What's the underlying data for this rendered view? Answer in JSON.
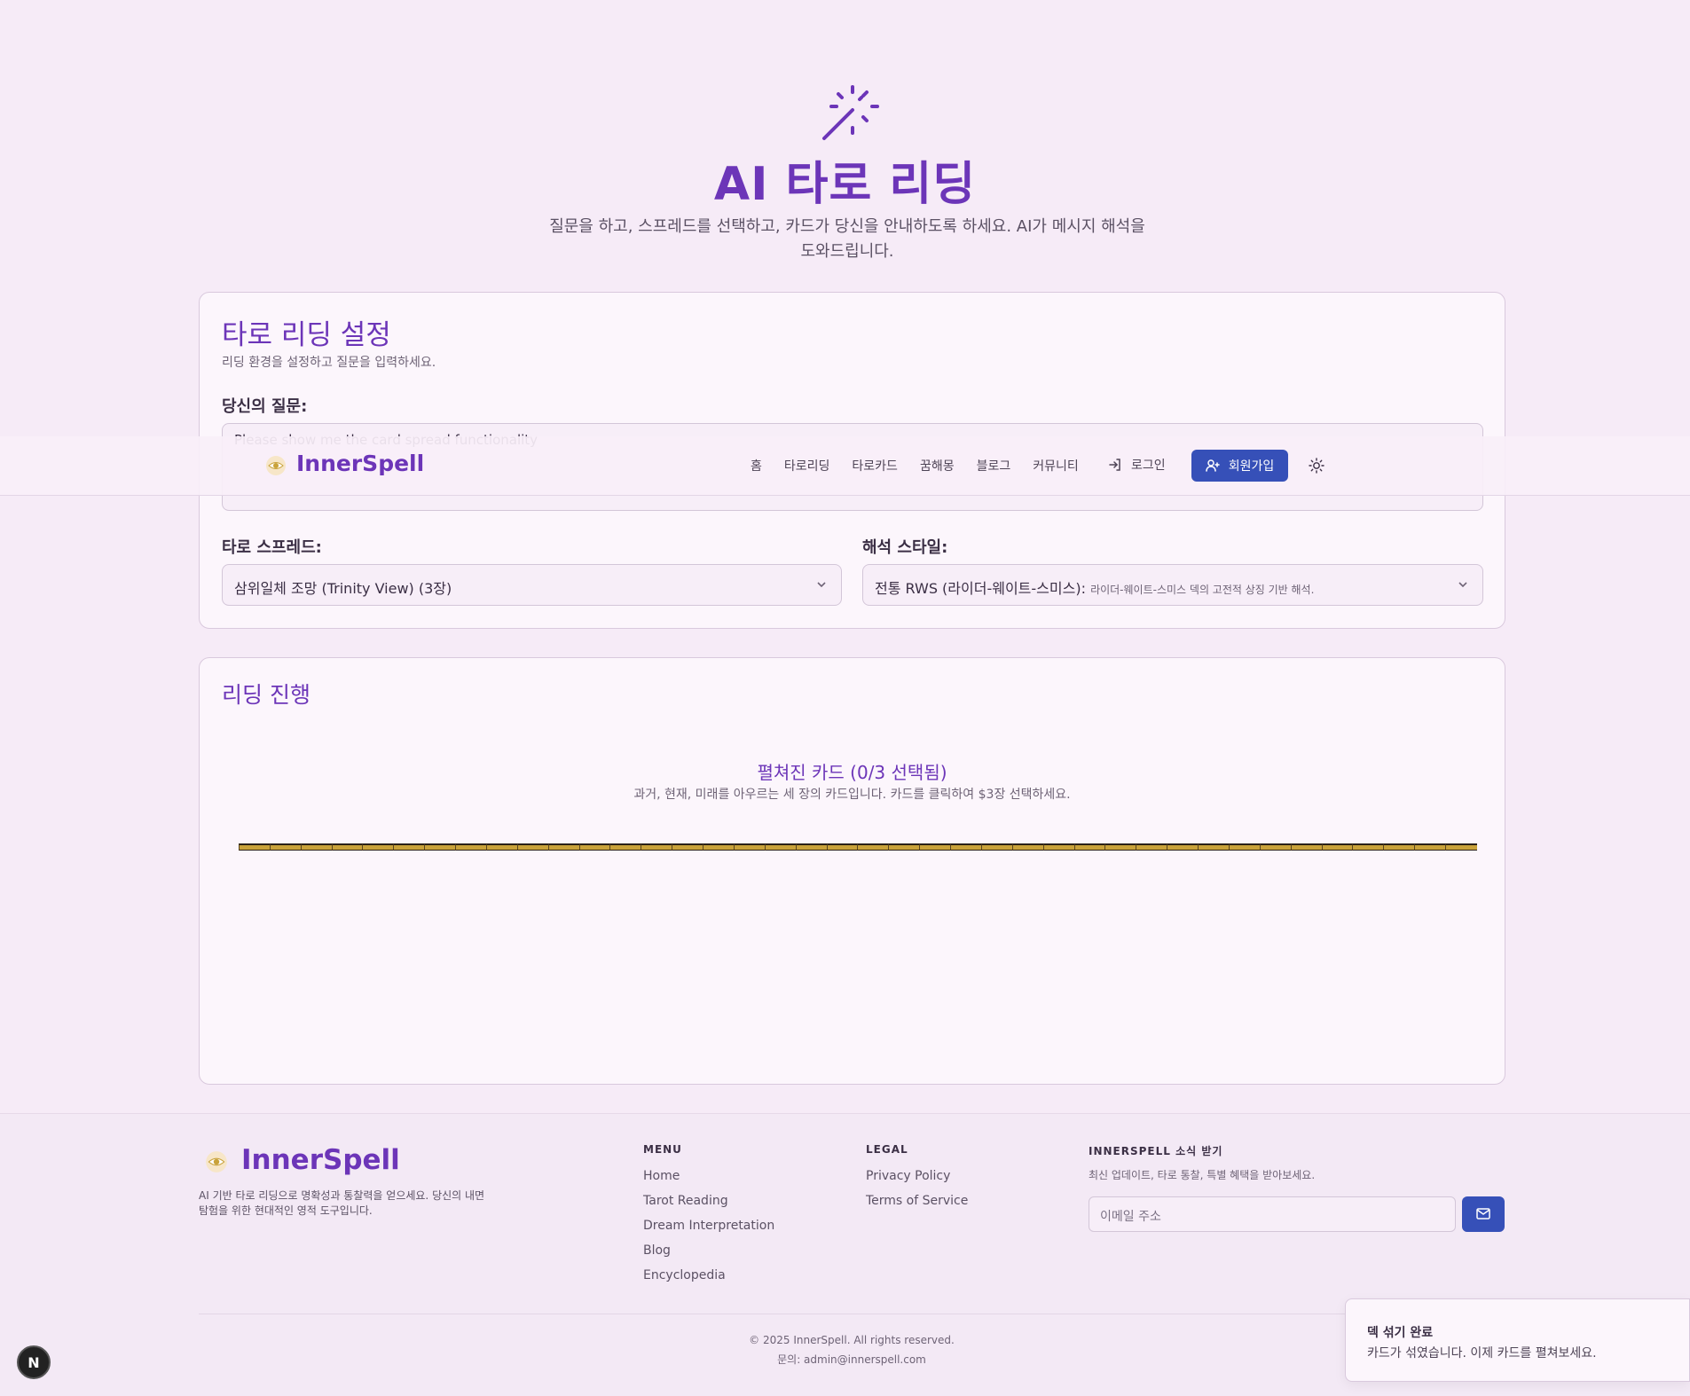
{
  "hero": {
    "title_ai": "AI",
    "title_rest": " 타로 리딩",
    "subtitle": "질문을 하고, 스프레드를 선택하고, 카드가 당신을 안내하도록 하세요. AI가 메시지 해석을 도와드립니다."
  },
  "settings": {
    "title": "타로 리딩 설정",
    "description": "리딩 환경을 설정하고 질문을 입력하세요.",
    "question_label": "당신의 질문:",
    "question_value": "Please show me the card spread functionality",
    "spread_label": "타로 스프레드:",
    "spread_value": "삼위일체 조망 (Trinity View) (3장)",
    "style_label": "해석 스타일:",
    "style_value": "전통 RWS (라이더-웨이트-스미스):",
    "style_hint": "라이더-웨이트-스미스 덱의 고전적 상징 기반 해석."
  },
  "progress": {
    "title": "리딩 진행",
    "spread_title": "펼쳐진 카드 (0/3 선택됨)",
    "spread_desc": "과거, 현재, 미래를 아우르는 세 장의 카드입니다. 카드를 클릭하여 $3장 선택하세요.",
    "selected": 0,
    "total": 3,
    "deck_card_count": 40
  },
  "nav": {
    "logo": "InnerSpell",
    "items": [
      "홈",
      "타로리딩",
      "타로카드",
      "꿈해몽",
      "블로그",
      "커뮤니티"
    ],
    "login": "로그인",
    "signup": "회원가입"
  },
  "footer": {
    "logo": "InnerSpell",
    "description": "AI 기반 타로 리딩으로 명확성과 통찰력을 얻으세요. 당신의 내면 탐험을 위한 현대적인 영적 도구입니다.",
    "menu_heading": "MENU",
    "menu": [
      "Home",
      "Tarot Reading",
      "Dream Interpretation",
      "Blog",
      "Encyclopedia"
    ],
    "legal_heading": "LEGAL",
    "legal": [
      "Privacy Policy",
      "Terms of Service"
    ],
    "news_heading": "INNERSPELL 소식 받기",
    "news_desc": "최신 업데이트, 타로 통찰, 특별 혜택을 받아보세요.",
    "email_placeholder": "이메일 주소",
    "copyright": "© 2025 InnerSpell. All rights reserved.",
    "contact": "문의: admin@innerspell.com"
  },
  "toast": {
    "title": "덱 섞기 완료",
    "message": "카드가 섞였습니다. 이제 카드를 펼쳐보세요."
  },
  "colors": {
    "accent": "#6c35b8",
    "primary_button": "#3650b8",
    "background": "#f6ebf7",
    "card_gold": "#c9a23a"
  },
  "icons": {
    "hero": "magic-wand-icon",
    "login": "log-in-icon",
    "signup": "user-plus-icon",
    "theme": "sun-icon",
    "send": "mail-icon"
  }
}
